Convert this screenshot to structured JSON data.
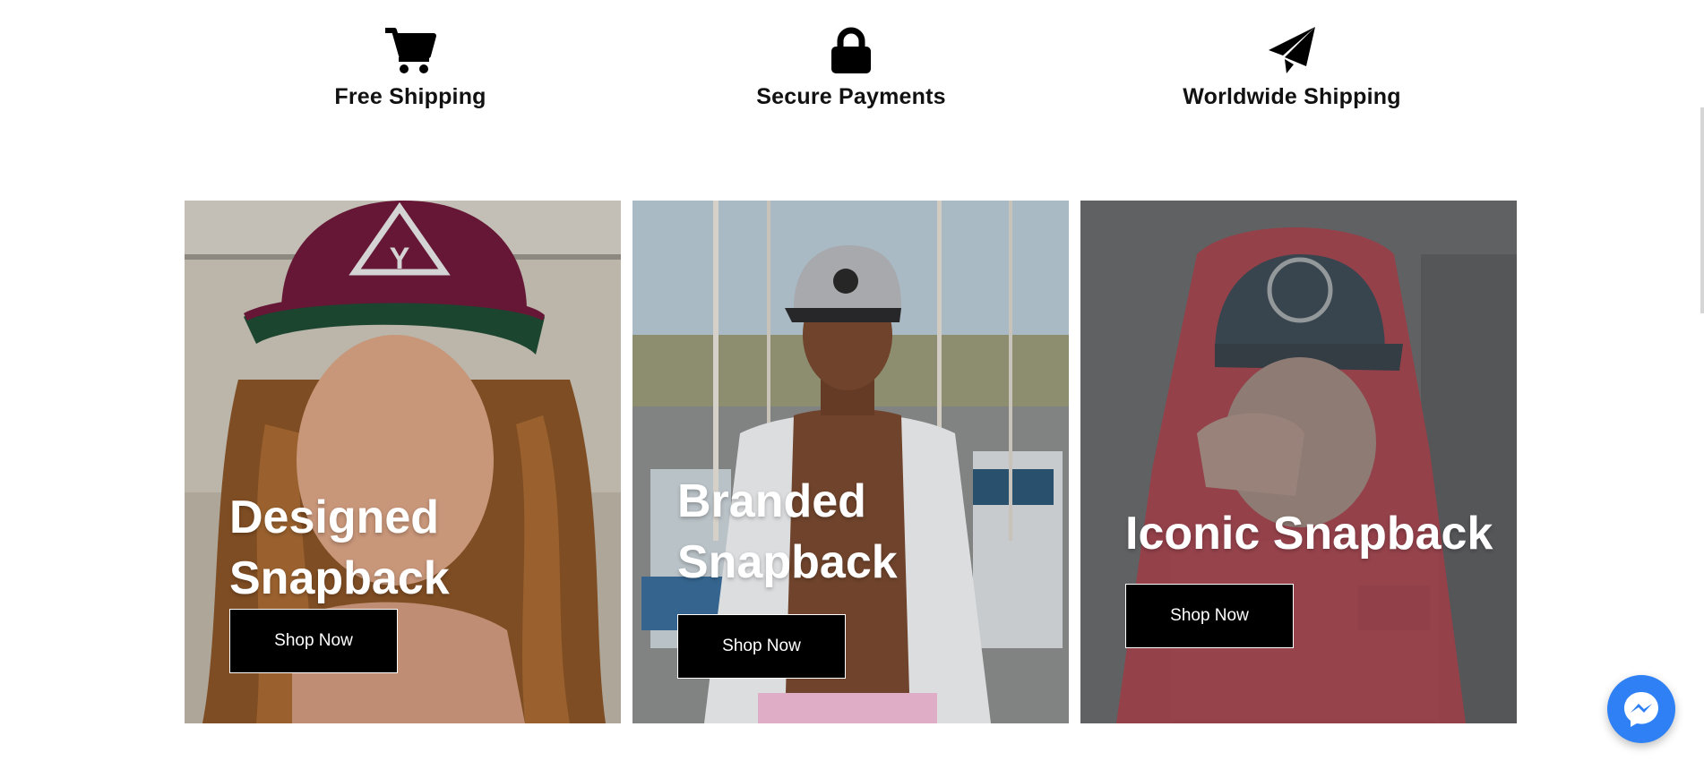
{
  "features": [
    {
      "icon": "cart-icon",
      "label": "Free Shipping"
    },
    {
      "icon": "lock-icon",
      "label": "Secure Payments"
    },
    {
      "icon": "paper-plane-icon",
      "label": "Worldwide Shipping"
    }
  ],
  "cards": [
    {
      "title": "Designed Snapback",
      "button": "Shop Now",
      "image": "woman-maroon-cap-photo"
    },
    {
      "title": "Branded Snapback",
      "button": "Shop Now",
      "image": "man-grey-cap-marina-photo"
    },
    {
      "title": "Iconic Snapback",
      "button": "Shop Now",
      "image": "person-red-hoodie-cap-photo"
    }
  ],
  "chat": {
    "icon": "messenger-icon"
  }
}
